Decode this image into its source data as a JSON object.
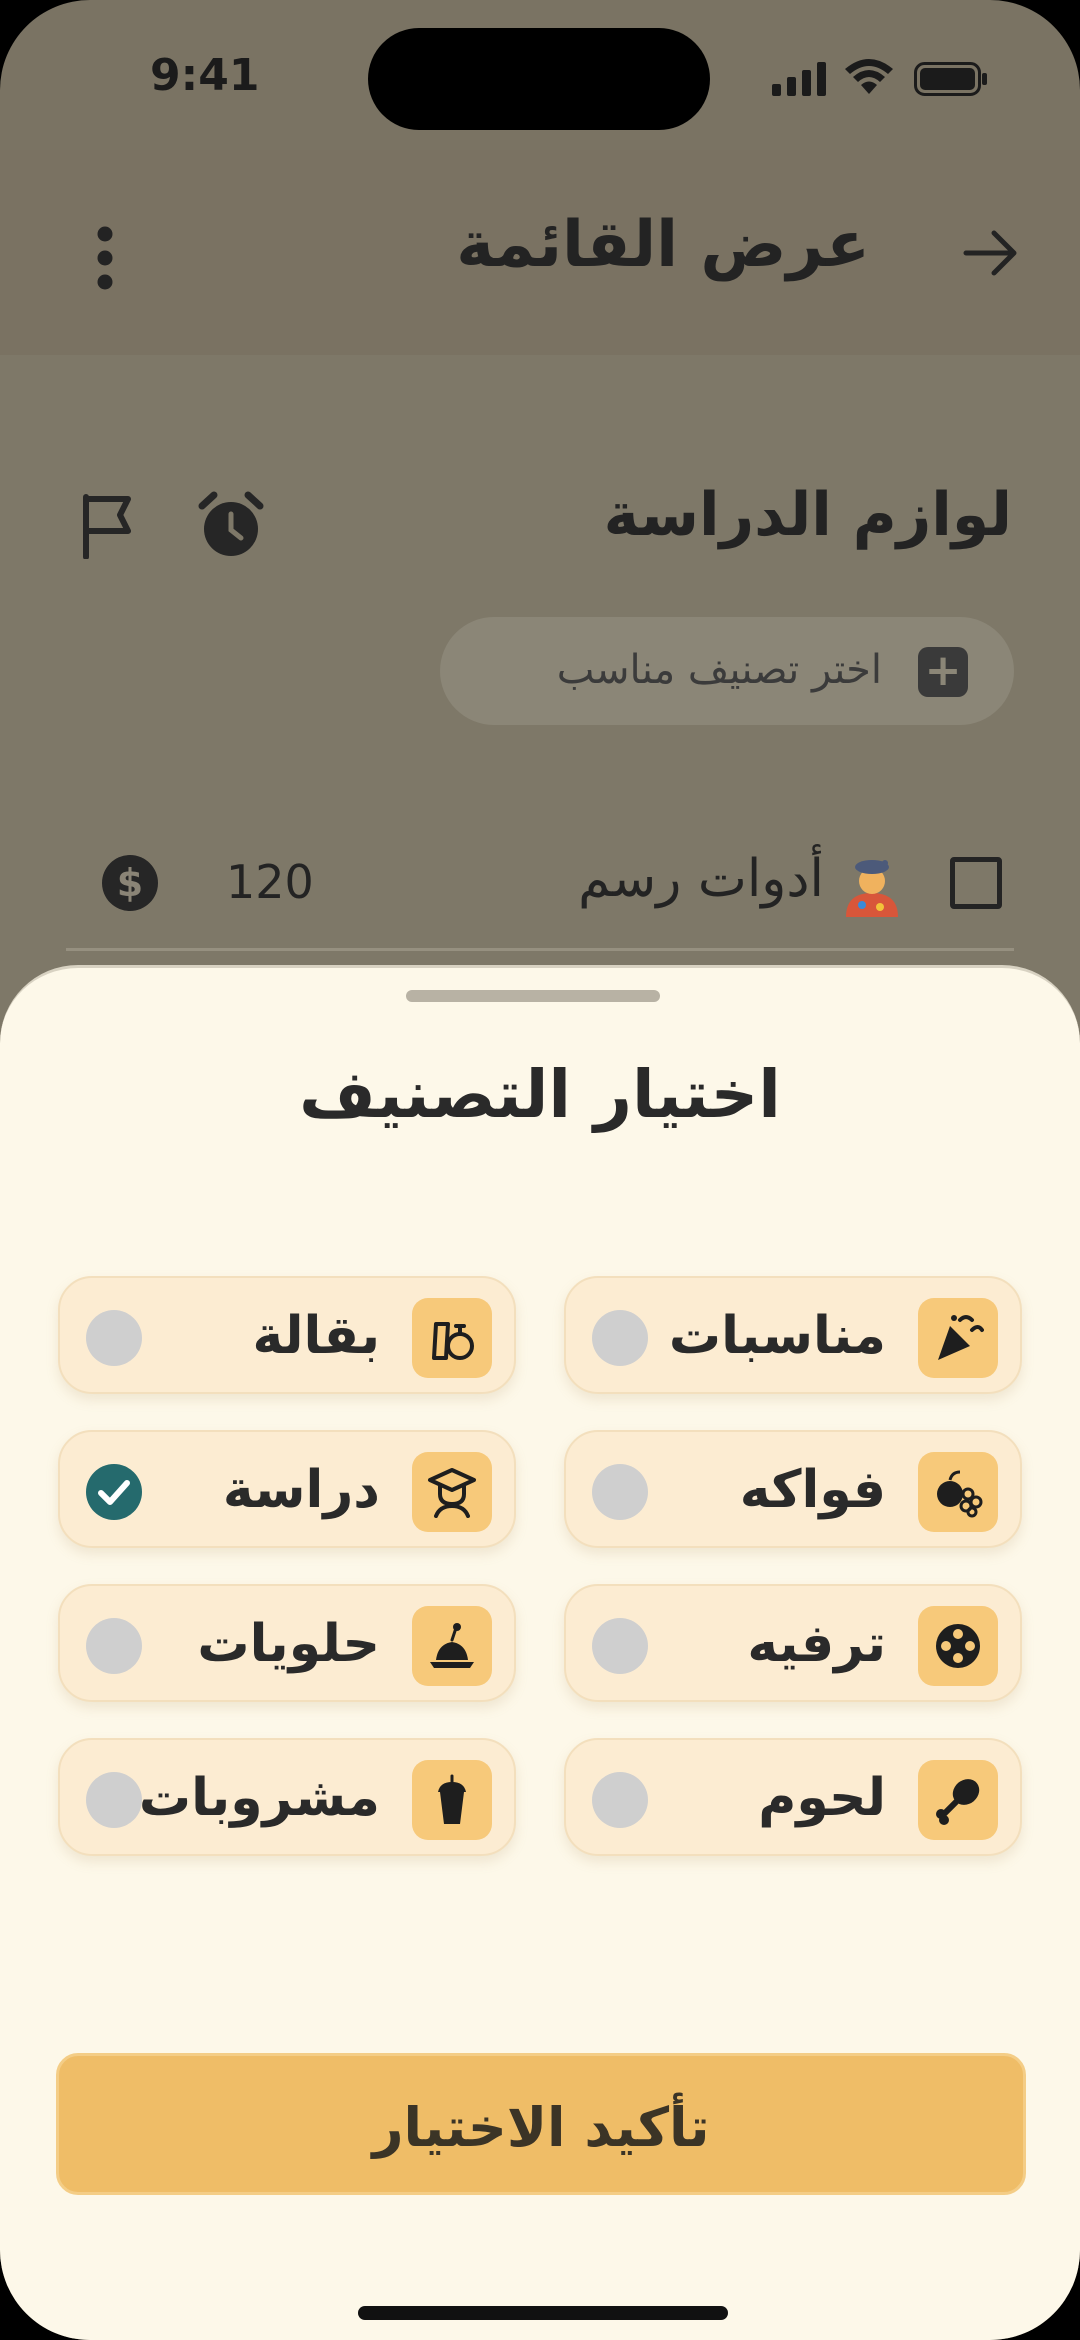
{
  "status_bar": {
    "time": "9:41"
  },
  "header": {
    "title": "عرض القائمة"
  },
  "list": {
    "title": "لوازم الدراسة",
    "category_picker_label": "اختر تصنيف مناسب",
    "item": {
      "name": "أدوات رسم",
      "price": "120",
      "currency_symbol": "$"
    }
  },
  "sheet": {
    "title": "اختيار التصنيف",
    "options": [
      {
        "label": "مناسبات",
        "icon": "party-icon",
        "selected": false
      },
      {
        "label": "بقالة",
        "icon": "grocery-icon",
        "selected": false
      },
      {
        "label": "فواكه",
        "icon": "fruits-icon",
        "selected": false
      },
      {
        "label": "دراسة",
        "icon": "graduate-icon",
        "selected": true
      },
      {
        "label": "ترفيه",
        "icon": "film-reel-icon",
        "selected": false
      },
      {
        "label": "حلويات",
        "icon": "pudding-icon",
        "selected": false
      },
      {
        "label": "لحوم",
        "icon": "drumstick-icon",
        "selected": false
      },
      {
        "label": "مشروبات",
        "icon": "cup-icon",
        "selected": false
      }
    ],
    "confirm_label": "تأكيد الاختيار"
  },
  "colors": {
    "accent": "#efbd67",
    "selected_radio": "#256a6d",
    "sheet_bg": "#fdf8e9"
  }
}
